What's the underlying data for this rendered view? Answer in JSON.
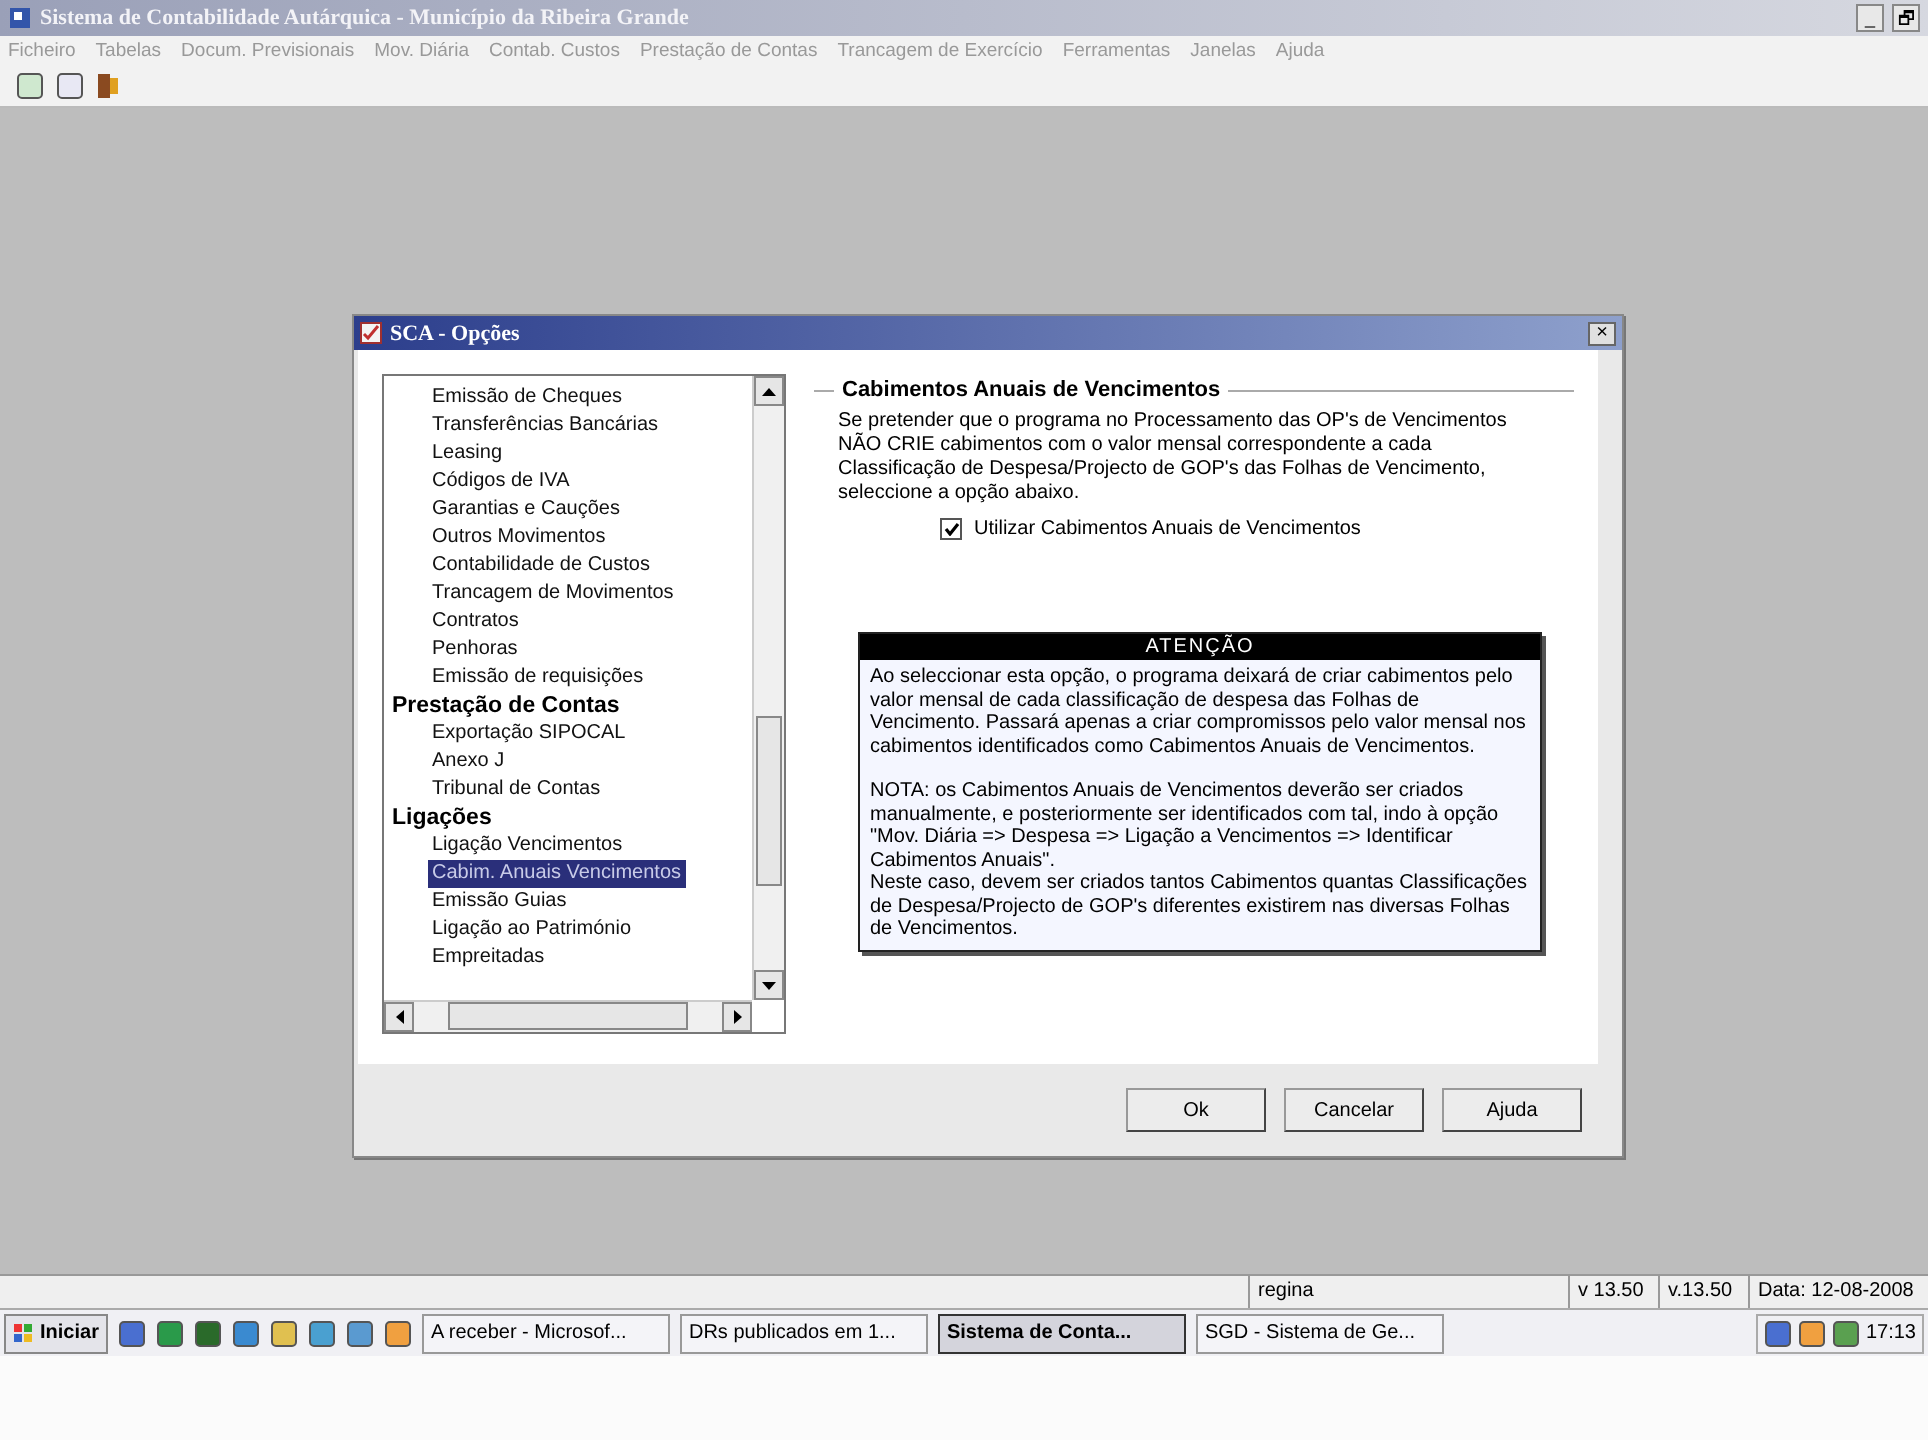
{
  "window": {
    "title": "Sistema de Contabilidade Autárquica - Município da Ribeira Grande",
    "controls": [
      "_",
      "🗗"
    ]
  },
  "menu": [
    "Ficheiro",
    "Tabelas",
    "Docum. Previsionais",
    "Mov. Diária",
    "Contab. Custos",
    "Prestação de Contas",
    "Trancagem de Exercício",
    "Ferramentas",
    "Janelas",
    "Ajuda"
  ],
  "dialog": {
    "title": "SCA - Opções",
    "close": "×",
    "tree": [
      {
        "children": [
          {
            "label": "Emissão de Cheques",
            "selected": false
          },
          {
            "label": "Transferências Bancárias",
            "selected": false
          },
          {
            "label": "Leasing",
            "selected": false
          },
          {
            "label": "Códigos de IVA",
            "selected": false
          },
          {
            "label": "Garantias e Cauções",
            "selected": false
          },
          {
            "label": "Outros Movimentos",
            "selected": false
          },
          {
            "label": "Contabilidade de Custos",
            "selected": false
          },
          {
            "label": "Trancagem de Movimentos",
            "selected": false
          },
          {
            "label": "Contratos",
            "selected": false
          },
          {
            "label": "Penhoras",
            "selected": false
          },
          {
            "label": "Emissão de requisições",
            "selected": false
          }
        ]
      },
      {
        "label": "Prestação de Contas",
        "children": [
          {
            "label": "Exportação SIPOCAL",
            "selected": false
          },
          {
            "label": "Anexo J",
            "selected": false
          },
          {
            "label": "Tribunal de Contas",
            "selected": false
          }
        ]
      },
      {
        "label": "Ligações",
        "children": [
          {
            "label": "Ligação Vencimentos",
            "selected": false
          },
          {
            "label": "Cabim. Anuais Vencimentos",
            "selected": true
          },
          {
            "label": "Emissão Guias",
            "selected": false
          },
          {
            "label": "Ligação ao Património",
            "selected": false
          },
          {
            "label": "Empreitadas",
            "selected": false
          }
        ]
      }
    ],
    "section_title": "Cabimentos Anuais de Vencimentos",
    "description": "Se pretender que o programa no Processamento das OP's de Vencimentos NÃO CRIE cabimentos com o valor mensal correspondente a cada Classificação de Despesa/Projecto de GOP's das Folhas de Vencimento, seleccione a opção abaixo.",
    "checkbox": {
      "label": "Utilizar Cabimentos Anuais de Vencimentos",
      "checked": true
    },
    "notice": {
      "title": "ATENÇÃO",
      "paragraphs": [
        "Ao seleccionar esta opção, o programa deixará de criar cabimentos pelo valor mensal de cada classificação de despesa das Folhas de Vencimento. Passará apenas a criar compromissos pelo valor mensal nos cabimentos identificados como Cabimentos Anuais de Vencimentos.",
        "NOTA: os Cabimentos Anuais de Vencimentos deverão ser criados manualmente, e posteriormente ser identificados com tal, indo à opção \"Mov. Diária => Despesa => Ligação a Vencimentos => Identificar Cabimentos Anuais\".\nNeste caso, devem ser criados tantos Cabimentos quantas Classificações de Despesa/Projecto de GOP's diferentes existirem nas diversas Folhas de Vencimentos."
      ]
    },
    "buttons": [
      "Ok",
      "Cancelar",
      "Ajuda"
    ]
  },
  "status_bar": [
    "regina",
    "v 13.50",
    "v.13.50",
    "Data: 12-08-2008"
  ],
  "taskbar": {
    "start": "Iniciar",
    "tasks": [
      {
        "label": "A receber - Microsof...",
        "selected": false
      },
      {
        "label": "DRs publicados em 1...",
        "selected": false
      },
      {
        "label": "Sistema de Conta...",
        "selected": true
      },
      {
        "label": "SGD - Sistema de Ge...",
        "selected": false
      }
    ],
    "clock": "17:13"
  }
}
